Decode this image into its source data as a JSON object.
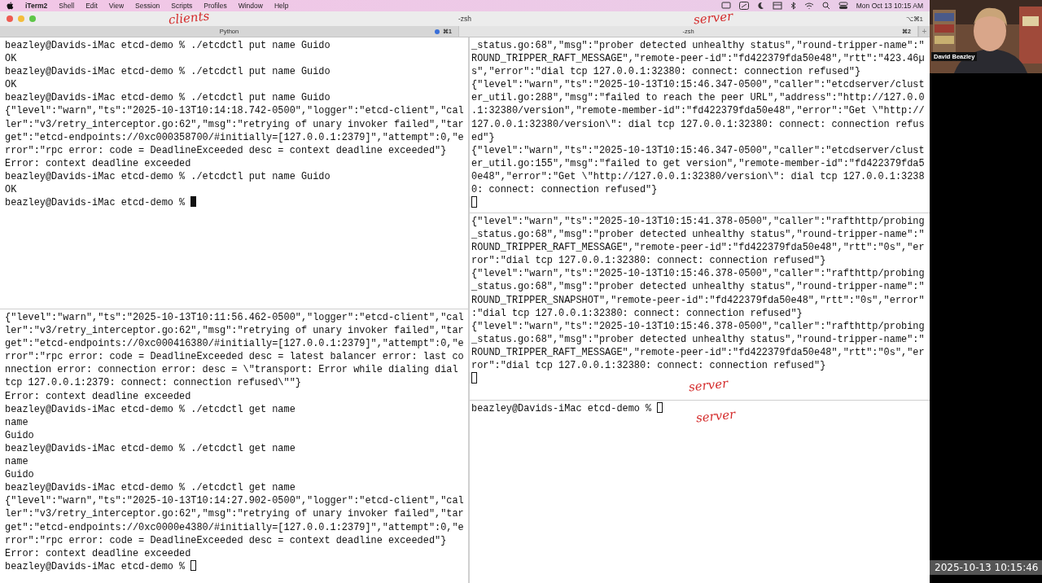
{
  "menu_bar": {
    "app": "iTerm2",
    "items": [
      "Shell",
      "Edit",
      "View",
      "Session",
      "Scripts",
      "Profiles",
      "Window",
      "Help"
    ],
    "clock": "Mon Oct 13  10:15 AM"
  },
  "window": {
    "title": "-zsh",
    "shortcut": "⌥⌘1"
  },
  "tabs": [
    {
      "label": "Python",
      "shortcut": "⌘1",
      "activity": true,
      "selected": false
    },
    {
      "label": "-zsh",
      "shortcut": "⌘2",
      "activity": false,
      "selected": true
    }
  ],
  "new_tab_button": "+",
  "columns": [
    {
      "panes": [
        {
          "focused": true,
          "cursor_on_new_line": false,
          "lines": [
            "beazley@Davids-iMac etcd-demo % ./etcdctl put name Guido",
            "OK",
            "beazley@Davids-iMac etcd-demo % ./etcdctl put name Guido",
            "OK",
            "beazley@Davids-iMac etcd-demo % ./etcdctl put name Guido",
            "{\"level\":\"warn\",\"ts\":\"2025-10-13T10:14:18.742-0500\",\"logger\":\"etcd-client\",\"cal",
            "ler\":\"v3/retry_interceptor.go:62\",\"msg\":\"retrying of unary invoker failed\",\"tar",
            "get\":\"etcd-endpoints://0xc000358700/#initially=[127.0.0.1:2379]\",\"attempt\":0,\"e",
            "rror\":\"rpc error: code = DeadlineExceeded desc = context deadline exceeded\"}",
            "Error: context deadline exceeded",
            "beazley@Davids-iMac etcd-demo % ./etcdctl put name Guido",
            "OK",
            "beazley@Davids-iMac etcd-demo % "
          ]
        },
        {
          "focused": false,
          "cursor_on_new_line": false,
          "lines": [
            "{\"level\":\"warn\",\"ts\":\"2025-10-13T10:11:56.462-0500\",\"logger\":\"etcd-client\",\"cal",
            "ler\":\"v3/retry_interceptor.go:62\",\"msg\":\"retrying of unary invoker failed\",\"tar",
            "get\":\"etcd-endpoints://0xc000416380/#initially=[127.0.0.1:2379]\",\"attempt\":0,\"e",
            "rror\":\"rpc error: code = DeadlineExceeded desc = latest balancer error: last co",
            "nnection error: connection error: desc = \\\"transport: Error while dialing dial",
            "tcp 127.0.0.1:2379: connect: connection refused\\\"\"}",
            "Error: context deadline exceeded",
            "beazley@Davids-iMac etcd-demo % ./etcdctl get name",
            "name",
            "Guido",
            "beazley@Davids-iMac etcd-demo % ./etcdctl get name",
            "name",
            "Guido",
            "beazley@Davids-iMac etcd-demo % ./etcdctl get name",
            "{\"level\":\"warn\",\"ts\":\"2025-10-13T10:14:27.902-0500\",\"logger\":\"etcd-client\",\"cal",
            "ler\":\"v3/retry_interceptor.go:62\",\"msg\":\"retrying of unary invoker failed\",\"tar",
            "get\":\"etcd-endpoints://0xc0000e4380/#initially=[127.0.0.1:2379]\",\"attempt\":0,\"e",
            "rror\":\"rpc error: code = DeadlineExceeded desc = context deadline exceeded\"}",
            "Error: context deadline exceeded",
            "beazley@Davids-iMac etcd-demo % "
          ]
        }
      ]
    },
    {
      "panes": [
        {
          "focused": false,
          "cursor_on_new_line": true,
          "lines": [
            "_status.go:68\",\"msg\":\"prober detected unhealthy status\",\"round-tripper-name\":\"",
            "ROUND_TRIPPER_RAFT_MESSAGE\",\"remote-peer-id\":\"fd422379fda50e48\",\"rtt\":\"423.46µ",
            "s\",\"error\":\"dial tcp 127.0.0.1:32380: connect: connection refused\"}",
            "{\"level\":\"warn\",\"ts\":\"2025-10-13T10:15:46.347-0500\",\"caller\":\"etcdserver/clust",
            "er_util.go:288\",\"msg\":\"failed to reach the peer URL\",\"address\":\"http://127.0.0",
            ".1:32380/version\",\"remote-member-id\":\"fd422379fda50e48\",\"error\":\"Get \\\"http://",
            "127.0.0.1:32380/version\\\": dial tcp 127.0.0.1:32380: connect: connection refus",
            "ed\"}",
            "{\"level\":\"warn\",\"ts\":\"2025-10-13T10:15:46.347-0500\",\"caller\":\"etcdserver/clust",
            "er_util.go:155\",\"msg\":\"failed to get version\",\"remote-member-id\":\"fd422379fda5",
            "0e48\",\"error\":\"Get \\\"http://127.0.0.1:32380/version\\\": dial tcp 127.0.0.1:3238",
            "0: connect: connection refused\"}"
          ]
        },
        {
          "focused": false,
          "cursor_on_new_line": true,
          "lines": [
            "{\"level\":\"warn\",\"ts\":\"2025-10-13T10:15:41.378-0500\",\"caller\":\"rafthttp/probing",
            "_status.go:68\",\"msg\":\"prober detected unhealthy status\",\"round-tripper-name\":\"",
            "ROUND_TRIPPER_RAFT_MESSAGE\",\"remote-peer-id\":\"fd422379fda50e48\",\"rtt\":\"0s\",\"er",
            "ror\":\"dial tcp 127.0.0.1:32380: connect: connection refused\"}",
            "{\"level\":\"warn\",\"ts\":\"2025-10-13T10:15:46.378-0500\",\"caller\":\"rafthttp/probing",
            "_status.go:68\",\"msg\":\"prober detected unhealthy status\",\"round-tripper-name\":\"",
            "ROUND_TRIPPER_SNAPSHOT\",\"remote-peer-id\":\"fd422379fda50e48\",\"rtt\":\"0s\",\"error\"",
            ":\"dial tcp 127.0.0.1:32380: connect: connection refused\"}",
            "{\"level\":\"warn\",\"ts\":\"2025-10-13T10:15:46.378-0500\",\"caller\":\"rafthttp/probing",
            "_status.go:68\",\"msg\":\"prober detected unhealthy status\",\"round-tripper-name\":\"",
            "ROUND_TRIPPER_RAFT_MESSAGE\",\"remote-peer-id\":\"fd422379fda50e48\",\"rtt\":\"0s\",\"er",
            "ror\":\"dial tcp 127.0.0.1:32380: connect: connection refused\"}"
          ]
        },
        {
          "focused": false,
          "cursor_on_new_line": false,
          "lines": [
            "beazley@Davids-iMac etcd-demo % "
          ]
        }
      ]
    }
  ],
  "annotations": [
    {
      "text": "clients"
    },
    {
      "text": "server"
    },
    {
      "text": "server"
    },
    {
      "text": "server"
    }
  ],
  "webcam": {
    "name_label": "David Beazley"
  },
  "timestamp": "2025-10-13 10:15:46"
}
